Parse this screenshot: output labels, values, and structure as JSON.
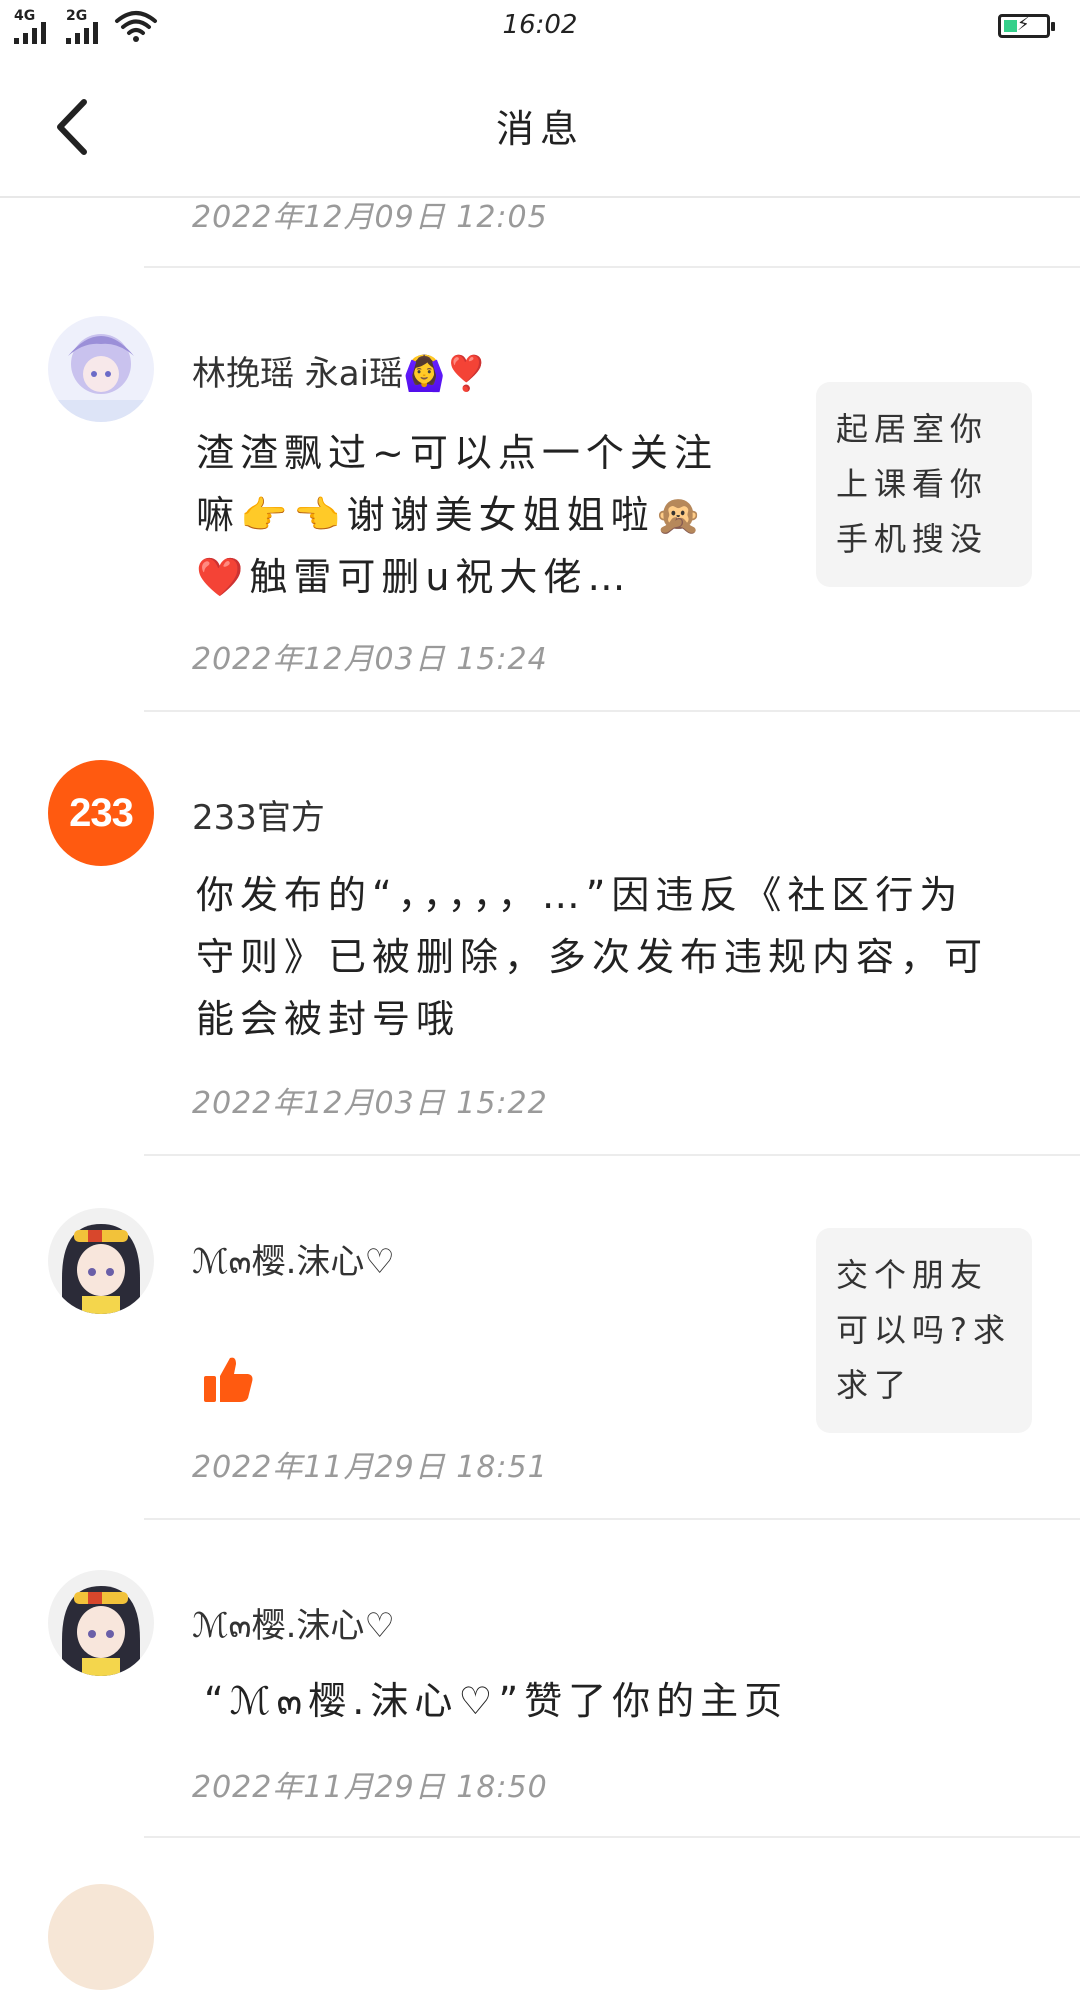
{
  "status_bar": {
    "net1": "4G",
    "net2": "2G",
    "time": "16:02"
  },
  "nav": {
    "title": "消息"
  },
  "top_item": {
    "time": "2022年12月09日  12:05"
  },
  "items": [
    {
      "name": "林挽瑶    永ai瑶🙆‍♀️❣️",
      "message": "渣渣飘过~可以点一个关注嘛👉👈谢谢美女姐姐啦🙊❤️触雷可删u祝大佬…",
      "time": "2022年12月03日  15:24",
      "quote": "起居室你上课看你手机搜没"
    },
    {
      "avatar_text": "233",
      "name": "233官方",
      "message": "你发布的“，，，，，…”因违反《社区行为守则》已被删除，多次发布违规内容，可能会被封号哦",
      "time": "2022年12月03日  15:22"
    },
    {
      "name": "ℳ๓樱.沫心♡",
      "time": "2022年11月29日  18:51",
      "quote": "交个朋友可以吗?求求了"
    },
    {
      "name": "ℳ๓樱.沫心♡",
      "message": "“ℳ๓樱.沫心♡”赞了你的主页",
      "time": "2022年11月29日  18:50"
    }
  ],
  "colors": {
    "brand_orange": "#ff5a10",
    "like_orange": "#ff5a10",
    "time_gray": "#9a9a9a"
  }
}
